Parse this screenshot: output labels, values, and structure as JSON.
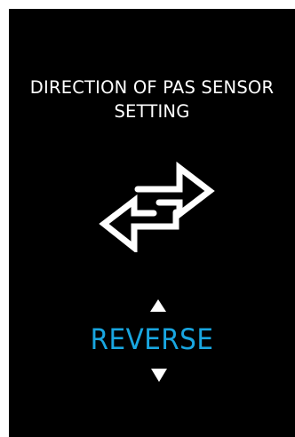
{
  "screen": {
    "title_line1": "DIRECTION OF PAS SENSOR",
    "title_line2": "SETTING",
    "value": "REVERSE",
    "icon": "swap-arrows-icon",
    "up_icon": "triangle-up-icon",
    "down_icon": "triangle-down-icon"
  },
  "colors": {
    "background": "#000000",
    "text": "#ffffff",
    "accent": "#19a6e0"
  }
}
